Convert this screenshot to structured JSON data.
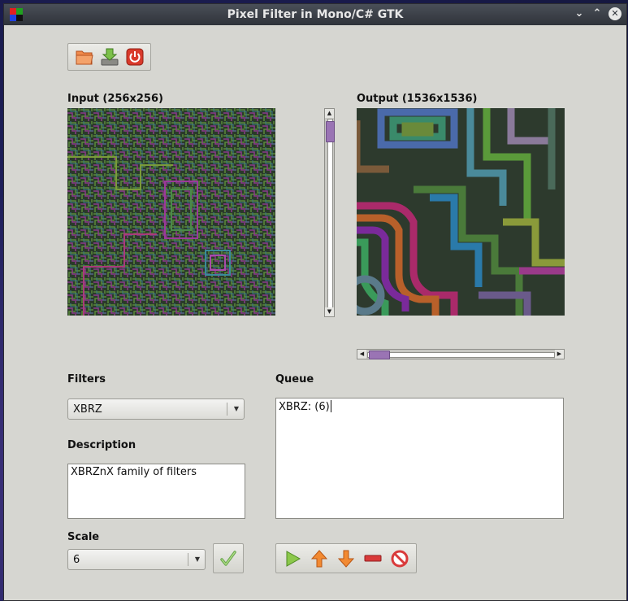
{
  "window": {
    "title": "Pixel Filter in Mono/C# GTK",
    "controls": [
      "chevron-down-icon",
      "chevron-up-icon",
      "close-icon"
    ]
  },
  "toolbar": {
    "buttons": [
      {
        "icon": "folder-open-icon",
        "color": "#e8643a"
      },
      {
        "icon": "save-download-icon",
        "color": "#6aa84f"
      },
      {
        "icon": "power-icon",
        "color": "#d93a2b"
      }
    ]
  },
  "input": {
    "label": "Input (256x256)"
  },
  "output": {
    "label": "Output (1536x1536)"
  },
  "filters": {
    "label": "Filters",
    "selected": "XBRZ"
  },
  "description": {
    "label": "Description",
    "text": "XBRZnX family of filters"
  },
  "scale": {
    "label": "Scale",
    "selected": "6"
  },
  "queue": {
    "label": "Queue",
    "text": "XBRZ: (6)"
  },
  "queue_toolbar": {
    "buttons": [
      "play-icon",
      "arrow-up-icon",
      "arrow-down-icon",
      "minus-icon",
      "stop-icon"
    ]
  },
  "colors": {
    "accent": "#9a74b4",
    "window_bg": "#d6d6d1"
  }
}
